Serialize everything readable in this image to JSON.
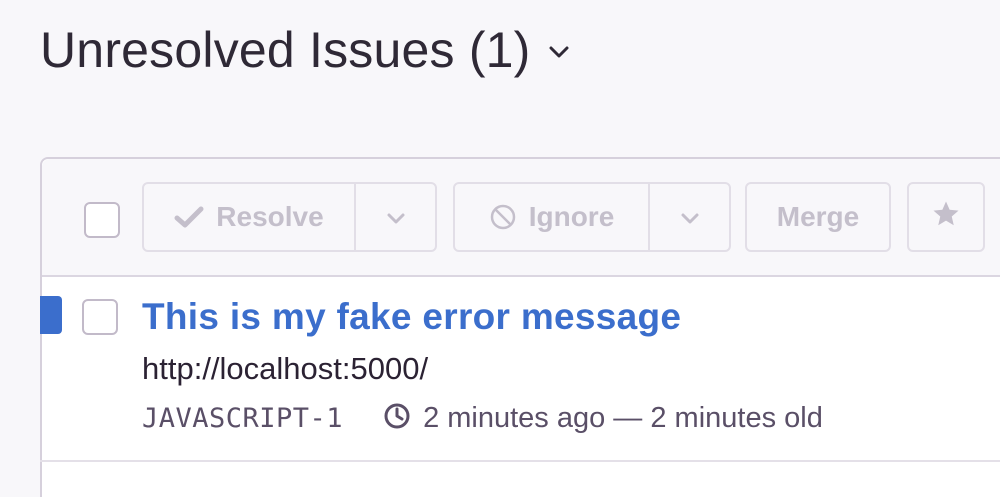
{
  "header": {
    "title": "Unresolved Issues",
    "count": "(1)"
  },
  "toolbar": {
    "resolve_label": "Resolve",
    "ignore_label": "Ignore",
    "merge_label": "Merge"
  },
  "issues": [
    {
      "title": "This is my fake error message",
      "url": "http://localhost:5000/",
      "short_id": "JAVASCRIPT-1",
      "time": "2 minutes ago — 2 minutes old",
      "unread": true
    }
  ],
  "icons": {
    "title_toggle": "chevron-down-icon",
    "resolve": "checkmark-icon",
    "ignore": "ban-icon",
    "bookmark": "star-icon",
    "time": "clock-icon"
  },
  "colors": {
    "accent": "#3b6ecc",
    "background": "#f8f7fa",
    "disabled_text": "#c4bfcb"
  }
}
